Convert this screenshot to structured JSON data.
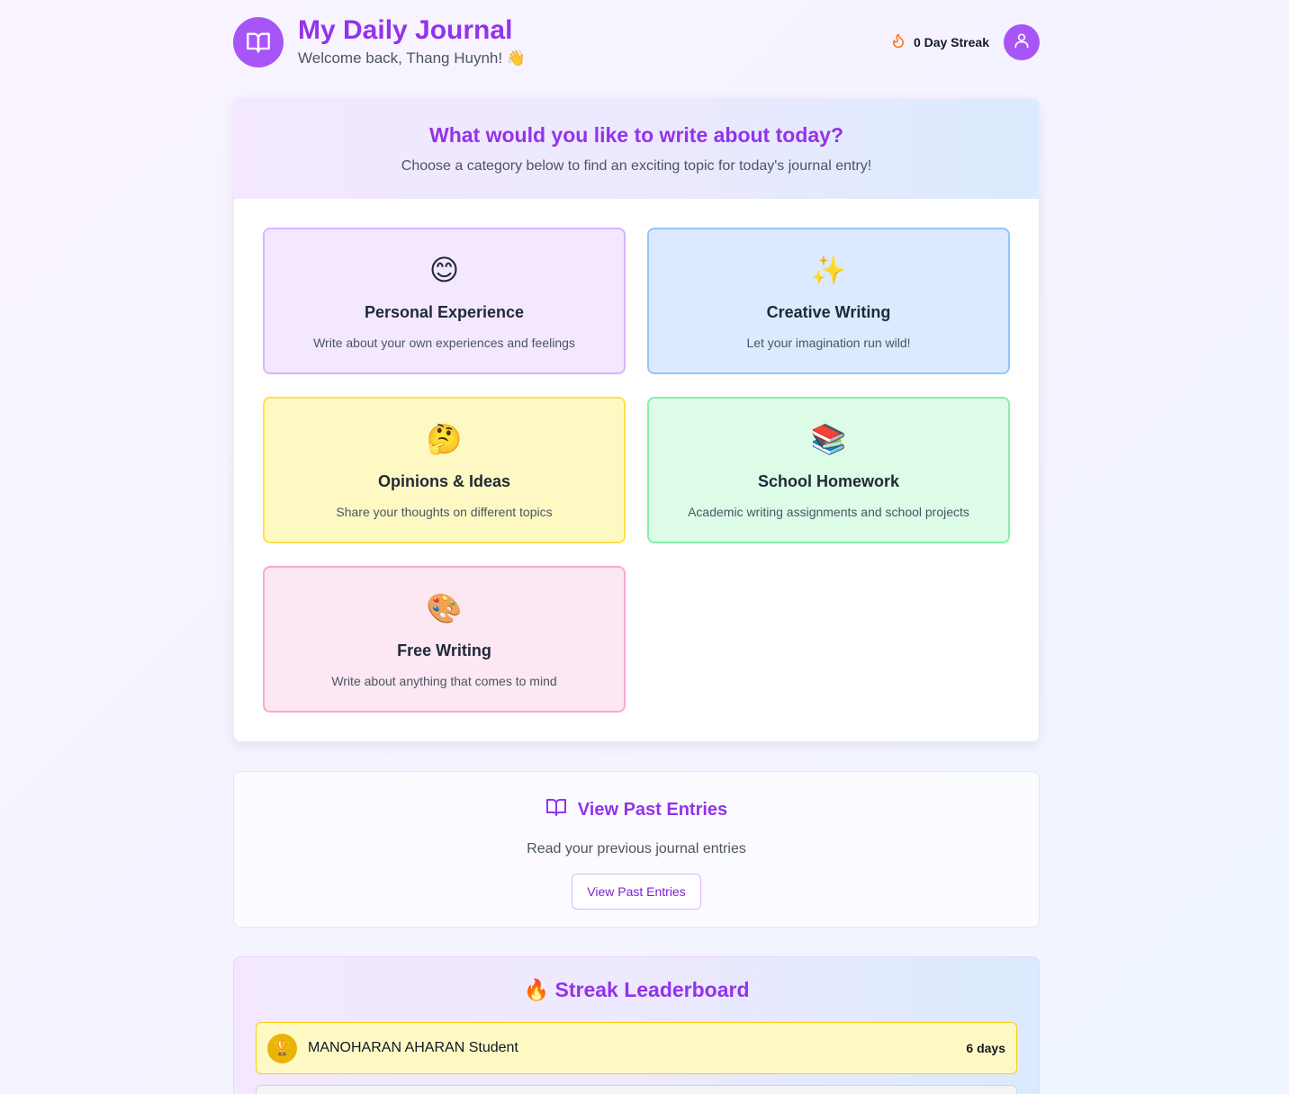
{
  "header": {
    "title": "My Daily Journal",
    "subtitle": "Welcome back, Thang Huynh! 👋",
    "streak_label": "0 Day Streak",
    "logo_icon": "book-open-icon",
    "streak_icon": "flame-icon",
    "avatar_icon": "user-icon"
  },
  "prompt": {
    "heading": "What would you like to write about today?",
    "description": "Choose a category below to find an exciting topic for today's journal entry!"
  },
  "categories": [
    {
      "emoji": "😊",
      "title": "Personal Experience",
      "description": "Write about your own experiences and feelings",
      "bg": "#f3e8ff",
      "border": "#d8b4fe"
    },
    {
      "emoji": "✨",
      "title": "Creative Writing",
      "description": "Let your imagination run wild!",
      "bg": "#dbeafe",
      "border": "#93c5fd"
    },
    {
      "emoji": "🤔",
      "title": "Opinions & Ideas",
      "description": "Share your thoughts on different topics",
      "bg": "#fef9c3",
      "border": "#fde047"
    },
    {
      "emoji": "📚",
      "title": "School Homework",
      "description": "Academic writing assignments and school projects",
      "bg": "#dcfce7",
      "border": "#86efac"
    },
    {
      "emoji": "🎨",
      "title": "Free Writing",
      "description": "Write about anything that comes to mind",
      "bg": "#fce7f3",
      "border": "#f9a8d4"
    }
  ],
  "past_entries": {
    "title": "View Past Entries",
    "description": "Read your previous journal entries",
    "button_label": "View Past Entries",
    "icon": "book-open-icon"
  },
  "leaderboard": {
    "title": "🔥 Streak Leaderboard",
    "entries": [
      {
        "rank_icon": "🏆",
        "name": "MANOHARAN AHARAN Student",
        "days": "6 days"
      }
    ]
  },
  "colors": {
    "accent": "#9333ea",
    "accent_light": "#a855f7",
    "streak_flame": "#f97316"
  }
}
